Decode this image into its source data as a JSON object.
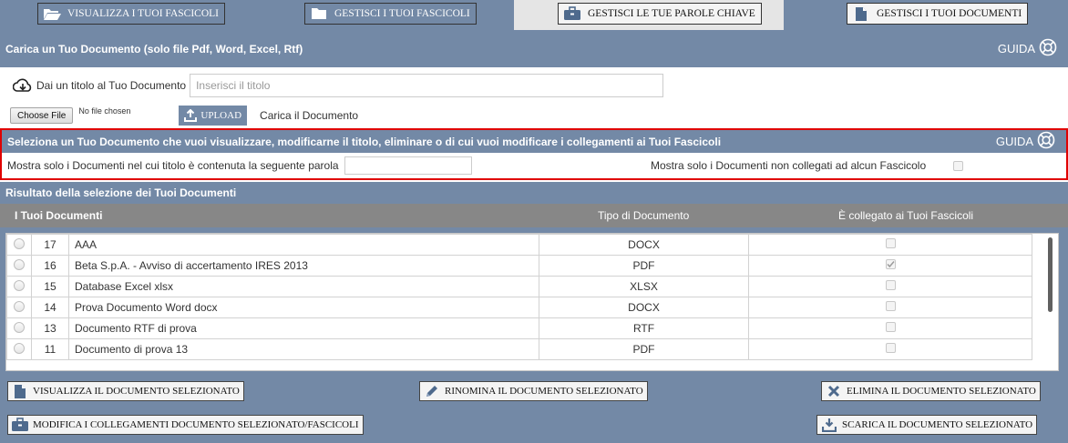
{
  "tabs": [
    {
      "label": "VISUALIZZA I TUOI FASCICOLI",
      "icon": "folder-open-icon"
    },
    {
      "label": "GESTISCI I TUOI FASCICOLI",
      "icon": "folder-icon"
    },
    {
      "label": "GESTISCI LE TUE PAROLE CHIAVE",
      "icon": "briefcase-icon"
    },
    {
      "label": "GESTISCI I TUOI DOCUMENTI",
      "icon": "document-icon"
    }
  ],
  "upload": {
    "title": "Carica un Tuo Documento (solo file Pdf, Word, Excel, Rtf)",
    "guide": "GUIDA",
    "title_label": "Dai un titolo al Tuo Documento",
    "title_placeholder": "Inserisci il titolo",
    "choose_file": "Choose File",
    "no_file": "No file chosen",
    "upload_label": "UPLOAD",
    "upload_hint": "Carica il Documento"
  },
  "filter": {
    "title": "Seleziona un Tuo Documento che vuoi visualizzare, modificarne il titolo, eliminare o di cui vuoi modificare i collegamenti ai Tuoi Fascicoli",
    "guide": "GUIDA",
    "word_label": "Mostra solo i Documenti nel cui titolo è contenuta la seguente parola",
    "word_value": "",
    "unlinked_label": "Mostra solo i Documenti non collegati ad alcun Fascicolo",
    "unlinked_checked": false
  },
  "results": {
    "title": "Risultato della selezione dei Tuoi Documenti",
    "columns": [
      "I Tuoi Documenti",
      "Tipo di Documento",
      "È collegato ai Tuoi Fascicoli"
    ],
    "rows": [
      {
        "id": "17",
        "name": "AAA",
        "type": "DOCX",
        "linked": false
      },
      {
        "id": "16",
        "name": "Beta S.p.A. - Avviso di accertamento IRES 2013",
        "type": "PDF",
        "linked": true
      },
      {
        "id": "15",
        "name": "Database Excel xlsx",
        "type": "XLSX",
        "linked": false
      },
      {
        "id": "14",
        "name": "Prova Documento Word docx",
        "type": "DOCX",
        "linked": false
      },
      {
        "id": "13",
        "name": "Documento RTF di prova",
        "type": "RTF",
        "linked": false
      },
      {
        "id": "11",
        "name": "Documento di prova 13",
        "type": "PDF",
        "linked": false
      }
    ]
  },
  "actions": {
    "view": "VISUALIZZA IL DOCUMENTO SELEZIONATO",
    "rename": "RINOMINA IL DOCUMENTO SELEZIONATO",
    "delete": "ELIMINA IL DOCUMENTO SELEZIONATO",
    "links": "MODIFICA I COLLEGAMENTI DOCUMENTO SELEZIONATO/FASCICOLI",
    "download": "SCARICA IL DOCUMENTO SELEZIONATO"
  },
  "colors": {
    "bar": "#7389a6",
    "highlight": "#e00000",
    "header_row": "#878787"
  }
}
